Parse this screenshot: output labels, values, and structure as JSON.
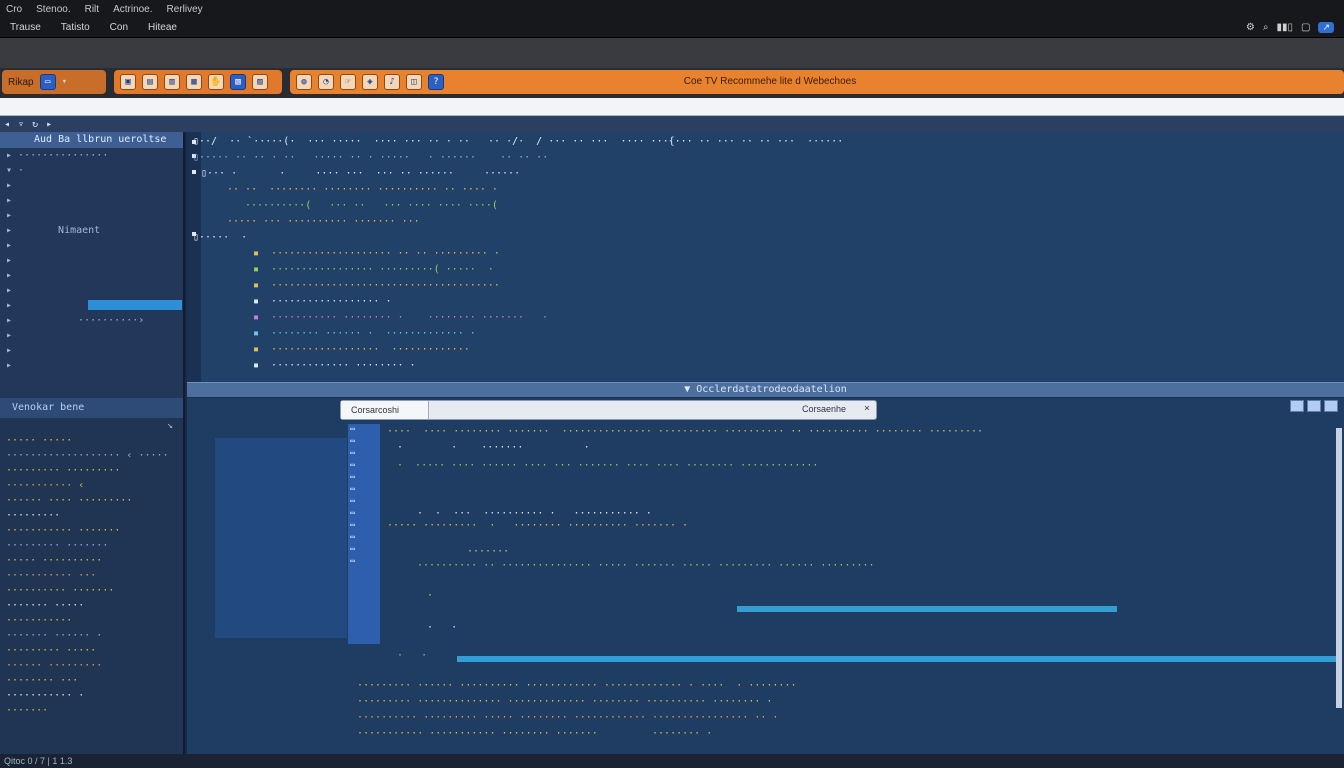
{
  "titlebar": {
    "menu_row1": [
      "Cro",
      "Stenoo.",
      "Rilt",
      "Actrinoe.",
      "Rerlivey"
    ],
    "menu_row2": [
      "Trause",
      "Tatisto",
      "Con",
      "Hiteae"
    ],
    "right_badge": "↗"
  },
  "toolbar": {
    "group1_label": "Rikap",
    "center_label": "Coe TV Recommehe lite d Webechoes"
  },
  "editor": {
    "divider_label": "▼ Occlerdatatrodeodaatelion",
    "findbar_value": "Corsarcoshi",
    "findbar_option": "Corsaenhe",
    "findbar_close": "×"
  },
  "sidebar": {
    "header": "Aud Ba llbrun ueroltse",
    "section_label": "Venokar bene",
    "item_selected_label": "Nimaent"
  },
  "statusbar": {
    "text": "Qitoc 0 / 7 | 1 1.3"
  },
  "colors": {
    "accent_orange": "#e8822e",
    "editor_bg": "#224168",
    "titlebar_bg": "#17181c"
  }
}
